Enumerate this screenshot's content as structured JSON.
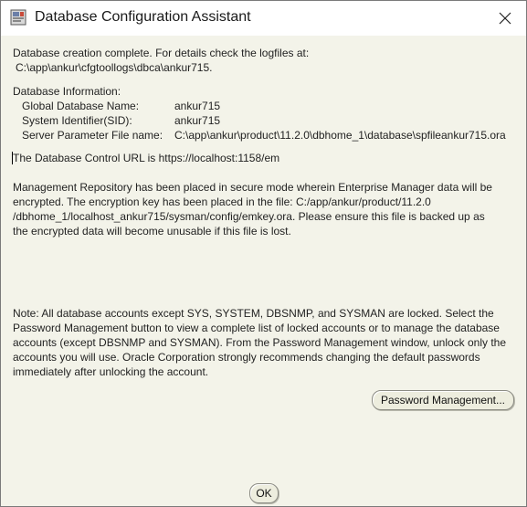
{
  "window": {
    "title": "Database Configuration Assistant",
    "icon": "oracle-dbca-app-icon",
    "close_icon": "close-icon"
  },
  "completion": {
    "line1": "Database creation complete. For details check the logfiles at:",
    "line2": "C:\\app\\ankur\\cfgtoollogs\\dbca\\ankur715."
  },
  "db_info": {
    "heading": "Database Information:",
    "rows": [
      {
        "label": "Global Database Name:",
        "value": "ankur715"
      },
      {
        "label": "System Identifier(SID):",
        "value": "ankur715"
      },
      {
        "label": "Server Parameter File name:",
        "value": "C:\\app\\ankur\\product\\11.2.0\\dbhome_1\\database\\spfileankur715.ora"
      }
    ]
  },
  "control_url": "The Database Control URL is https://localhost:1158/em",
  "repository_note": [
    "Management Repository has been placed in secure mode wherein Enterprise Manager data will be",
    "encrypted.  The encryption key has been placed in the file: C:/app/ankur/product/11.2.0",
    "/dbhome_1/localhost_ankur715/sysman/config/emkey.ora.   Please ensure this file is backed up as",
    "the encrypted data will become unusable if this file is lost."
  ],
  "accounts_note": [
    "Note: All database accounts except SYS, SYSTEM, DBSNMP, and SYSMAN are locked. Select the",
    "Password Management button to view a complete list of locked accounts or to manage the database",
    "accounts (except DBSNMP and SYSMAN). From the Password Management window, unlock only the",
    "accounts you will use. Oracle Corporation strongly recommends changing the default passwords",
    "immediately after unlocking the account."
  ],
  "buttons": {
    "password_management": "Password Management...",
    "ok": "OK"
  }
}
